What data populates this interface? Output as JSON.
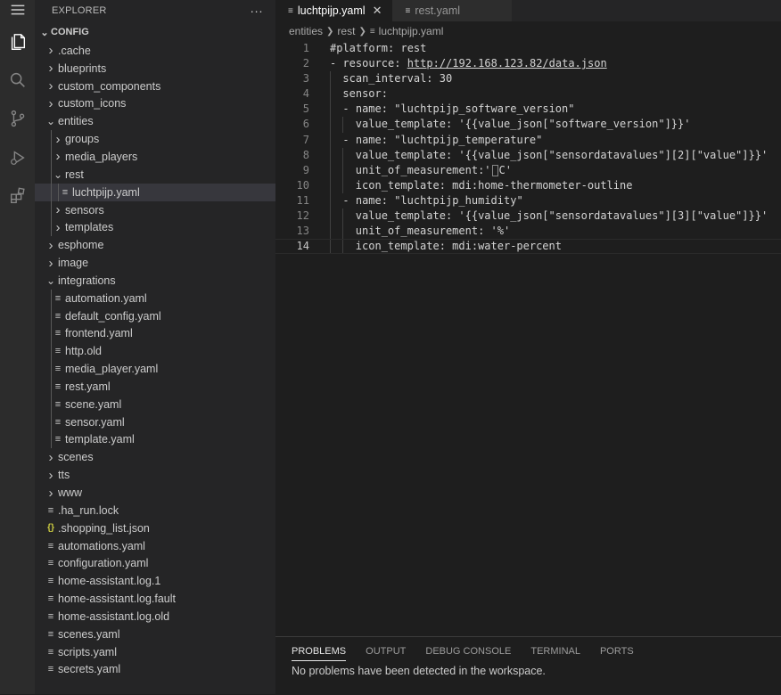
{
  "activity_bar": {
    "items": [
      "menu-icon",
      "files-icon",
      "search-icon",
      "source-control-icon",
      "run-debug-icon",
      "extensions-icon"
    ]
  },
  "sidebar": {
    "title": "EXPLORER",
    "more": "···",
    "section": "CONFIG",
    "tree": [
      {
        "label": ".cache",
        "depth": 0,
        "kind": "folder",
        "open": false
      },
      {
        "label": "blueprints",
        "depth": 0,
        "kind": "folder",
        "open": false
      },
      {
        "label": "custom_components",
        "depth": 0,
        "kind": "folder",
        "open": false
      },
      {
        "label": "custom_icons",
        "depth": 0,
        "kind": "folder",
        "open": false
      },
      {
        "label": "entities",
        "depth": 0,
        "kind": "folder",
        "open": true
      },
      {
        "label": "groups",
        "depth": 1,
        "kind": "folder",
        "open": false
      },
      {
        "label": "media_players",
        "depth": 1,
        "kind": "folder",
        "open": false
      },
      {
        "label": "rest",
        "depth": 1,
        "kind": "folder",
        "open": true
      },
      {
        "label": "luchtpijp.yaml",
        "depth": 2,
        "kind": "file",
        "selected": true
      },
      {
        "label": "sensors",
        "depth": 1,
        "kind": "folder",
        "open": false
      },
      {
        "label": "templates",
        "depth": 1,
        "kind": "folder",
        "open": false
      },
      {
        "label": "esphome",
        "depth": 0,
        "kind": "folder",
        "open": false
      },
      {
        "label": "image",
        "depth": 0,
        "kind": "folder",
        "open": false
      },
      {
        "label": "integrations",
        "depth": 0,
        "kind": "folder",
        "open": true
      },
      {
        "label": "automation.yaml",
        "depth": 1,
        "kind": "file"
      },
      {
        "label": "default_config.yaml",
        "depth": 1,
        "kind": "file"
      },
      {
        "label": "frontend.yaml",
        "depth": 1,
        "kind": "file"
      },
      {
        "label": "http.old",
        "depth": 1,
        "kind": "file"
      },
      {
        "label": "media_player.yaml",
        "depth": 1,
        "kind": "file"
      },
      {
        "label": "rest.yaml",
        "depth": 1,
        "kind": "file"
      },
      {
        "label": "scene.yaml",
        "depth": 1,
        "kind": "file"
      },
      {
        "label": "sensor.yaml",
        "depth": 1,
        "kind": "file"
      },
      {
        "label": "template.yaml",
        "depth": 1,
        "kind": "file"
      },
      {
        "label": "scenes",
        "depth": 0,
        "kind": "folder",
        "open": false
      },
      {
        "label": "tts",
        "depth": 0,
        "kind": "folder",
        "open": false
      },
      {
        "label": "www",
        "depth": 0,
        "kind": "folder",
        "open": false
      },
      {
        "label": ".ha_run.lock",
        "depth": 0,
        "kind": "file"
      },
      {
        "label": ".shopping_list.json",
        "depth": 0,
        "kind": "json"
      },
      {
        "label": "automations.yaml",
        "depth": 0,
        "kind": "file"
      },
      {
        "label": "configuration.yaml",
        "depth": 0,
        "kind": "file"
      },
      {
        "label": "home-assistant.log.1",
        "depth": 0,
        "kind": "file"
      },
      {
        "label": "home-assistant.log.fault",
        "depth": 0,
        "kind": "file"
      },
      {
        "label": "home-assistant.log.old",
        "depth": 0,
        "kind": "file"
      },
      {
        "label": "scenes.yaml",
        "depth": 0,
        "kind": "file"
      },
      {
        "label": "scripts.yaml",
        "depth": 0,
        "kind": "file"
      },
      {
        "label": "secrets.yaml",
        "depth": 0,
        "kind": "file"
      }
    ]
  },
  "tabs": [
    {
      "label": "luchtpijp.yaml",
      "active": true
    },
    {
      "label": "rest.yaml",
      "active": false
    }
  ],
  "breadcrumb": [
    "entities",
    "rest",
    "luchtpijp.yaml"
  ],
  "editor": {
    "lines": [
      {
        "num": "1",
        "indent": 0,
        "text": "#platform: rest"
      },
      {
        "num": "2",
        "indent": 0,
        "pre": "- resource: ",
        "link": "http://192.168.123.82/data.json"
      },
      {
        "num": "3",
        "indent": 1,
        "text": "scan_interval: 30"
      },
      {
        "num": "4",
        "indent": 1,
        "text": "sensor:"
      },
      {
        "num": "5",
        "indent": 1,
        "text": "- name: \"luchtpijp_software_version\""
      },
      {
        "num": "6",
        "indent": 2,
        "text": "value_template: '{{value_json[\"software_version\"]}}'"
      },
      {
        "num": "7",
        "indent": 1,
        "text": "- name: \"luchtpijp_temperature\""
      },
      {
        "num": "8",
        "indent": 2,
        "text": "value_template: '{{value_json[\"sensordatavalues\"][2][\"value\"]}}'"
      },
      {
        "num": "9",
        "indent": 2,
        "pre": "unit_of_measurement:'",
        "post": "C'"
      },
      {
        "num": "10",
        "indent": 2,
        "text": "icon_template: mdi:home-thermometer-outline"
      },
      {
        "num": "11",
        "indent": 1,
        "text": "- name: \"luchtpijp_humidity\""
      },
      {
        "num": "12",
        "indent": 2,
        "text": "value_template: '{{value_json[\"sensordatavalues\"][3][\"value\"]}}'"
      },
      {
        "num": "13",
        "indent": 2,
        "text": "unit_of_measurement: '%'"
      },
      {
        "num": "14",
        "indent": 2,
        "text": "icon_template: mdi:water-percent",
        "current": true
      }
    ]
  },
  "panel": {
    "tabs": [
      "PROBLEMS",
      "OUTPUT",
      "DEBUG CONSOLE",
      "TERMINAL",
      "PORTS"
    ],
    "active_tab": "PROBLEMS",
    "message": "No problems have been detected in the workspace."
  }
}
